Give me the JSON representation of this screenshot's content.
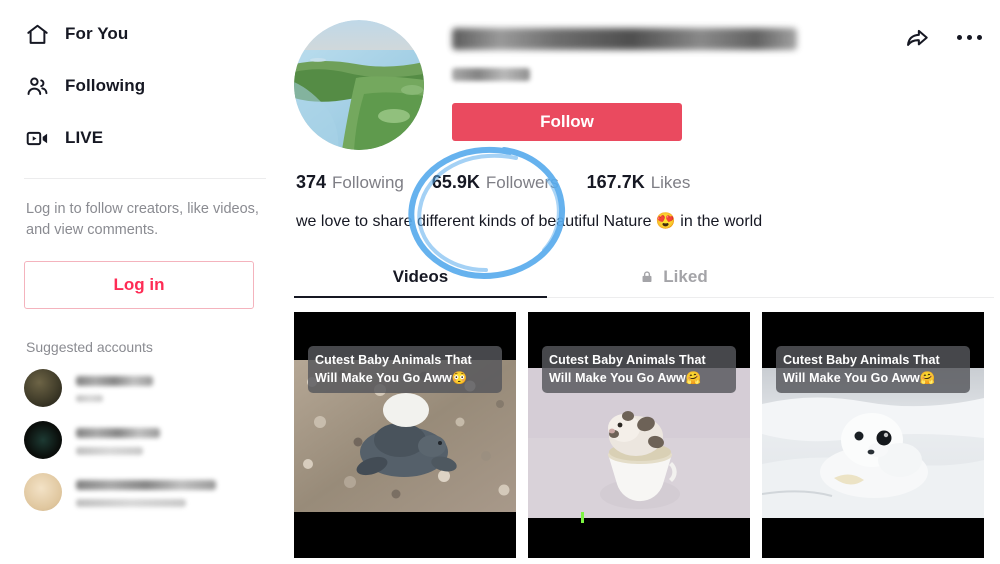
{
  "sidebar": {
    "nav": [
      {
        "label": "For You",
        "icon": "home-icon"
      },
      {
        "label": "Following",
        "icon": "people-icon"
      },
      {
        "label": "LIVE",
        "icon": "live-video-icon"
      }
    ],
    "login_prompt": "Log in to follow creators, like videos, and view comments.",
    "login_button": "Log in",
    "suggested_title": "Suggested accounts",
    "suggested": [
      {
        "avatar_color": "#4a4032",
        "name_redacted": true,
        "sub_redacted": true,
        "name_width": 77,
        "sub_width": 27
      },
      {
        "avatar_color": "#0c0d0a",
        "name_redacted": true,
        "sub_redacted": true,
        "name_width": 84,
        "sub_width": 67
      },
      {
        "avatar_color": "#e8d2b0",
        "name_redacted": true,
        "sub_redacted": true,
        "name_width": 140,
        "sub_width": 110
      }
    ]
  },
  "profile": {
    "avatar_alt": "aerial nature landscape with river and trees",
    "username_redacted": true,
    "display_name_redacted": true,
    "follow_button": "Follow",
    "stats": [
      {
        "value": "374",
        "label": "Following"
      },
      {
        "value": "65.9K",
        "label": "Followers"
      },
      {
        "value": "167.7K",
        "label": "Likes"
      }
    ],
    "bio": "we love to share different kinds of beautiful Nature 😍 in the world",
    "tabs": [
      {
        "label": "Videos",
        "active": true,
        "locked": false
      },
      {
        "label": "Liked",
        "active": false,
        "locked": true
      }
    ]
  },
  "videos": [
    {
      "caption_line1": "Cutest Baby Animals That",
      "caption_line2": "Will Make You Go Aww",
      "caption_emoji": "😳",
      "subject": "baby-sea-turtle-on-pebbles",
      "has_progress_tick": false
    },
    {
      "caption_line1": "Cutest Baby Animals That",
      "caption_line2": "Will Make You Go Aww",
      "caption_emoji": "🤗",
      "subject": "hedgehog-in-teacup",
      "has_progress_tick": true
    },
    {
      "caption_line1": "Cutest Baby Animals That",
      "caption_line2": "Will Make You Go Aww",
      "caption_emoji": "🤗",
      "subject": "baby-seal-on-snow",
      "has_progress_tick": false
    }
  ],
  "annotation": {
    "type": "hand-drawn-circle",
    "color": "#5aaced",
    "targets": "65.9K Followers"
  },
  "colors": {
    "accent_red": "#ea4a5f",
    "login_red": "#fe2c55",
    "text_dark": "#161823",
    "text_grey": "#8a8b91",
    "annotation_blue": "#5aaced"
  }
}
